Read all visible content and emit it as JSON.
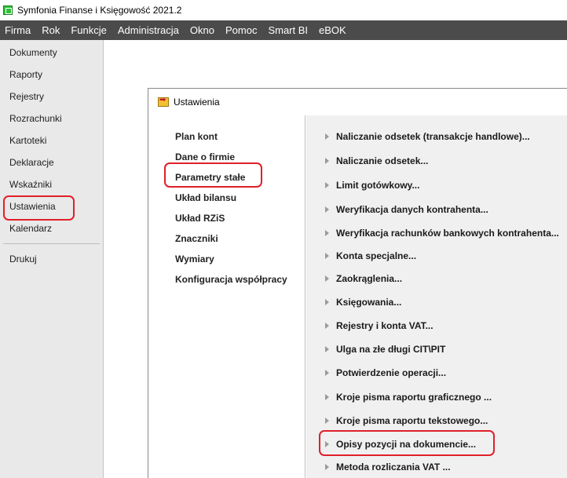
{
  "window": {
    "title": "Symfonia Finanse i Księgowość 2021.2"
  },
  "menu": [
    "Firma",
    "Rok",
    "Funkcje",
    "Administracja",
    "Okno",
    "Pomoc",
    "Smart BI",
    "eBOK"
  ],
  "sidebar": {
    "items": [
      "Dokumenty",
      "Raporty",
      "Rejestry",
      "Rozrachunki",
      "Kartoteki",
      "Deklaracje",
      "Wskaźniki",
      "Ustawienia",
      "Kalendarz"
    ],
    "bottom_items": [
      "Drukuj"
    ],
    "selected": "Ustawienia"
  },
  "settings_window": {
    "title": "Ustawienia",
    "left_items": [
      "Plan kont",
      "Dane o firmie",
      "Parametry stałe",
      "Układ bilansu",
      "Układ RZiS",
      "Znaczniki",
      "Wymiary",
      "Konfiguracja współpracy"
    ],
    "selected_left": "Parametry stałe",
    "right_items": [
      "Naliczanie odsetek (transakcje handlowe)...",
      "Naliczanie odsetek...",
      "Limit gotówkowy...",
      "Weryfikacja danych kontrahenta...",
      "Weryfikacja rachunków bankowych kontrahenta...",
      "Konta specjalne...",
      "Zaokrąglenia...",
      "Księgowania...",
      "Rejestry i konta VAT...",
      "Ulga na złe długi CIT\\PIT",
      "Potwierdzenie operacji...",
      "Kroje pisma raportu graficznego ...",
      "Kroje pisma raportu tekstowego...",
      "Opisy pozycji na dokumencie...",
      "Metoda rozliczania VAT ..."
    ],
    "highlighted_right": "Opisy pozycji na dokumencie..."
  },
  "colors": {
    "menubar": "#4b4b4b",
    "sidebar": "#e9e9e9",
    "highlight": "#e0202a",
    "right_panel": "#f0f0f0"
  }
}
